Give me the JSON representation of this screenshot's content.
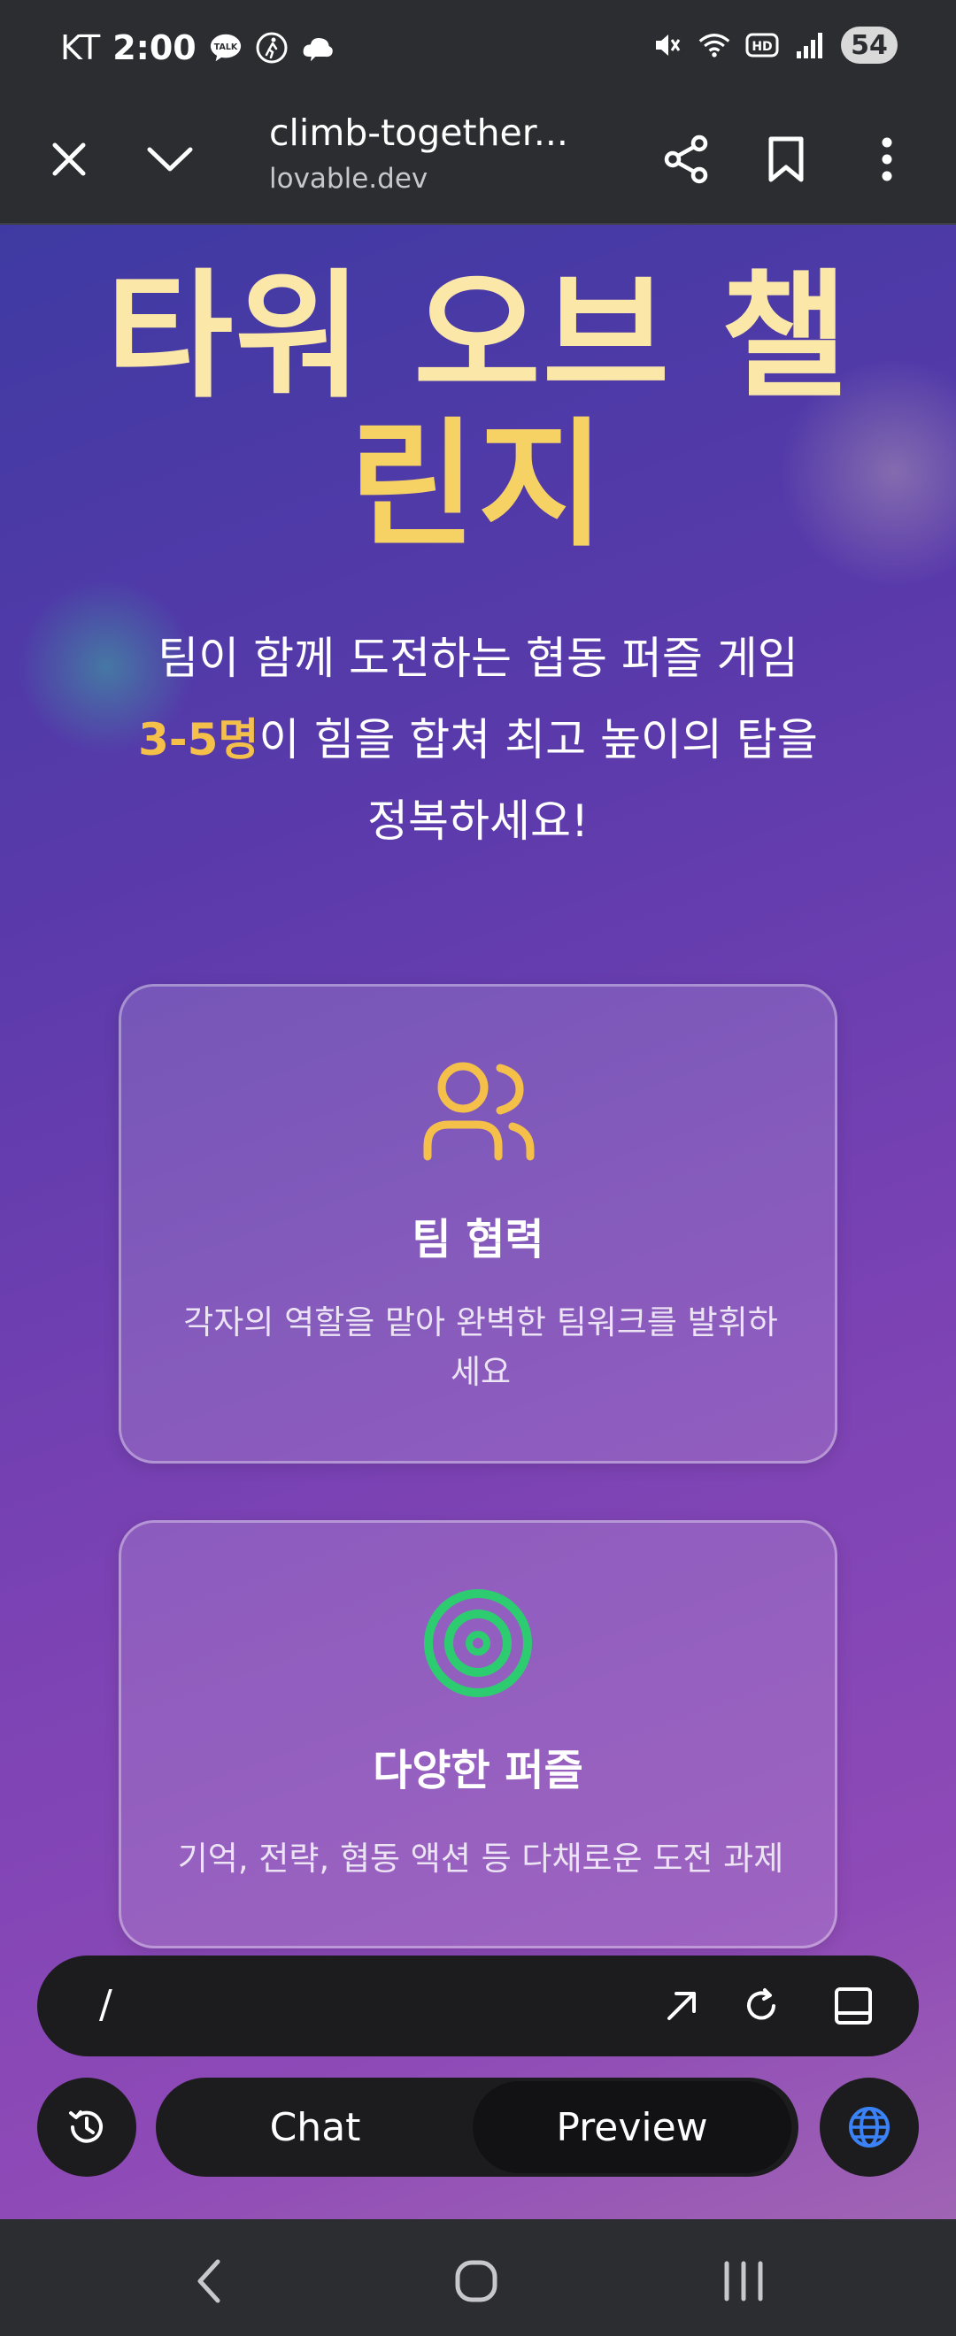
{
  "status_bar": {
    "carrier": "KT",
    "time": "2:00",
    "talk_badge": "TALK",
    "battery": "54",
    "icons": [
      "talk-icon",
      "walk-icon",
      "cloud-icon",
      "mute-icon",
      "wifi-icon",
      "hd-icon",
      "signal-icon"
    ]
  },
  "browser": {
    "title": "climb-together...",
    "domain": "lovable.dev",
    "icons": [
      "close-icon",
      "chevron-down-icon",
      "share-icon",
      "bookmark-icon",
      "more-vertical-icon"
    ]
  },
  "hero": {
    "title_line1": "타워 오브 챌",
    "title_line2": "린지",
    "subtitle_line1": "팀이 함께 도전하는 협동 퍼즐 게임",
    "subtitle_highlight": "3-5명",
    "subtitle_line2_rest": "이 힘을 합쳐 최고 높이의 탑을",
    "subtitle_line3": "정복하세요!"
  },
  "features": [
    {
      "icon": "users-icon",
      "title": "팀 협력",
      "desc_line1": "각자의 역할을 맡아 완벽한 팀워크를 발휘하",
      "desc_line2": "세요"
    },
    {
      "icon": "target-icon",
      "title": "다양한 퍼즐",
      "desc_line1": "기억, 전략, 협동 액션 등 다채로운 도전 과제"
    }
  ],
  "url_bar": {
    "path": "/",
    "icons": [
      "open-external-icon",
      "refresh-icon",
      "panel-icon"
    ]
  },
  "bottom_controls": {
    "chat_label": "Chat",
    "preview_label": "Preview",
    "active_tab": "Preview",
    "icons": [
      "history-icon",
      "globe-icon"
    ]
  },
  "nav_bar": {
    "icons": [
      "back-icon",
      "home-icon",
      "recents-icon"
    ]
  },
  "colors": {
    "title": "#fbe8a8",
    "highlight": "#f5c04a",
    "users_icon": "#f5c04a",
    "target_icon": "#2ecc71",
    "globe_icon": "#3b82f6"
  }
}
